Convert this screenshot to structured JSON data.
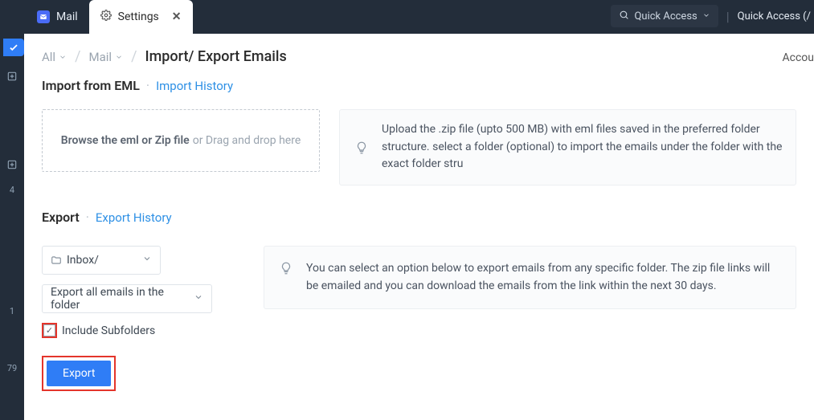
{
  "topbar": {
    "tab_mail": "Mail",
    "tab_settings": "Settings",
    "qa_pill": "Quick Access",
    "qa_right": "Quick Access  (/"
  },
  "leftrail": {
    "badge1": "4",
    "badge2": "1",
    "badge3": "79"
  },
  "breadcrumb": {
    "all": "All",
    "mail": "Mail",
    "current": "Import/ Export Emails",
    "account": "Accou"
  },
  "import": {
    "title": "Import from EML",
    "history": "Import History",
    "drop_strong": "Browse the eml or Zip file",
    "drop_rest": " or Drag and drop here",
    "hint": "Upload the .zip file (upto 500 MB) with eml files saved in the preferred folder structure. select a folder (optional) to import the emails under the folder with the exact folder stru"
  },
  "export": {
    "title": "Export",
    "history": "Export History",
    "folder": "Inbox/",
    "scope": "Export all emails in the folder",
    "include_sub": "Include Subfolders",
    "button": "Export",
    "hint": "You can select an option below to export emails from any specific folder. The zip file links will be emailed and you can download the emails from the link within the next 30 days."
  }
}
